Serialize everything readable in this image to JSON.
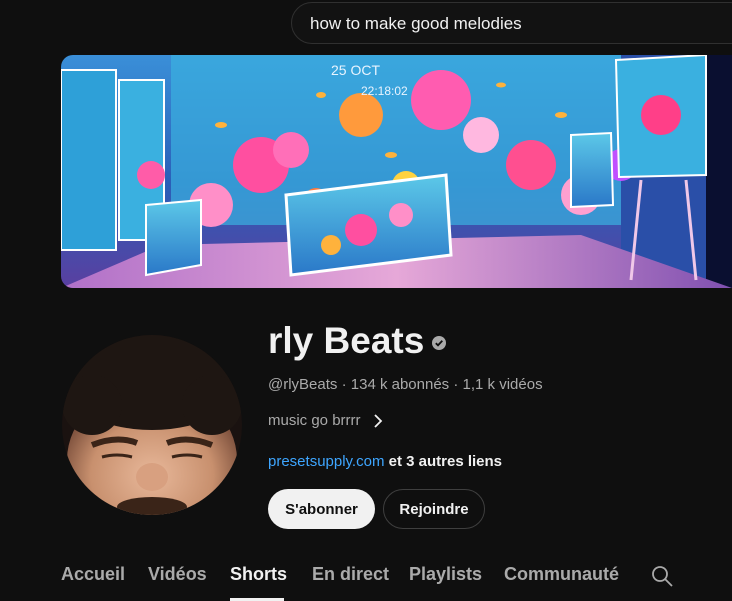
{
  "search": {
    "query": "how to make good melodies"
  },
  "banner": {
    "date_text": "25 OCT",
    "time_text": "22:18:02"
  },
  "channel": {
    "name": "rly Beats",
    "verified_icon": "verified-check-icon",
    "handle": "@rlyBeats",
    "subscribers": "134 k abonnés",
    "videos": "1,1 k vidéos",
    "separator": " · ",
    "description": "music go brrrr",
    "link": "presetsupply.com",
    "more_links": " et 3 autres liens"
  },
  "buttons": {
    "subscribe": "S'abonner",
    "join": "Rejoindre"
  },
  "tabs": [
    {
      "label": "Accueil",
      "active": false
    },
    {
      "label": "Vidéos",
      "active": false
    },
    {
      "label": "Shorts",
      "active": true
    },
    {
      "label": "En direct",
      "active": false
    },
    {
      "label": "Playlists",
      "active": false
    },
    {
      "label": "Communauté",
      "active": false
    }
  ],
  "colors": {
    "background": "#0f0f0f",
    "text": "#f1f1f1",
    "secondary_text": "#aaaaaa",
    "link": "#3ea6ff",
    "subscribe_bg": "#f1f1f1"
  }
}
